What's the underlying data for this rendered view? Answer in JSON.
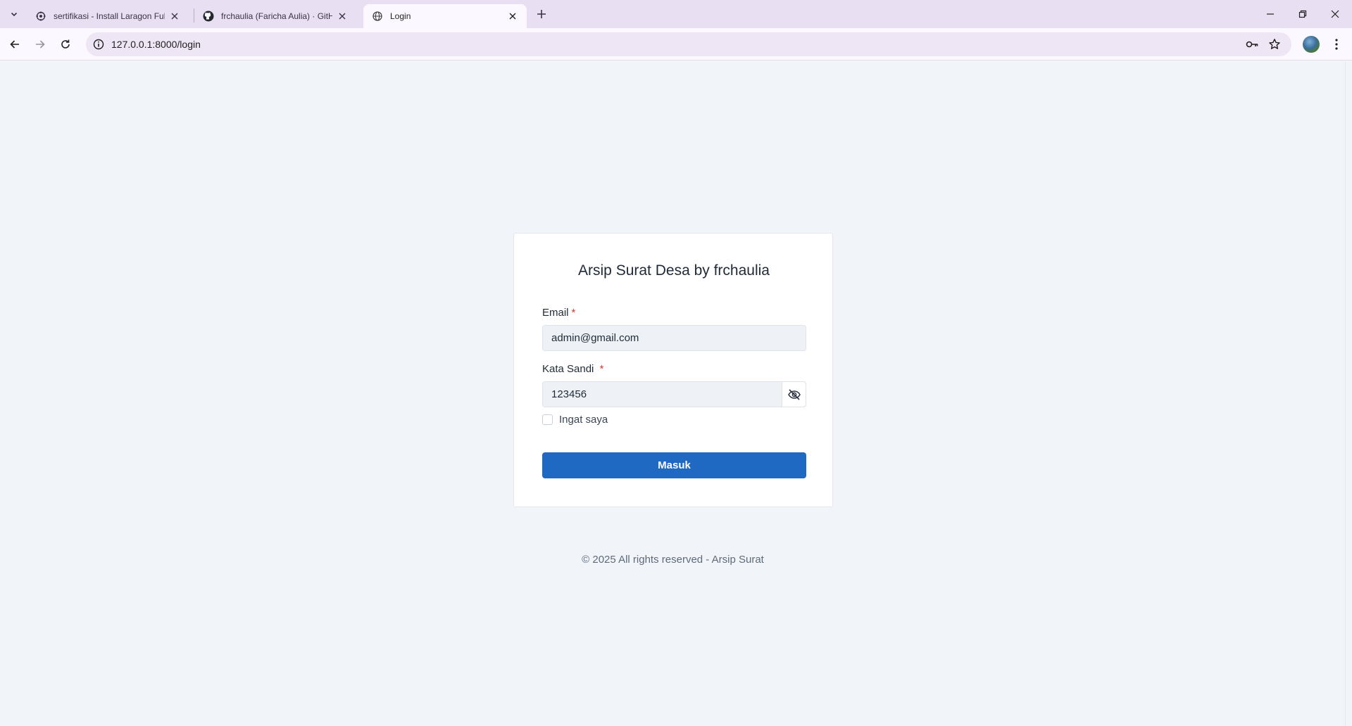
{
  "browser": {
    "tabs": [
      {
        "title": "sertifikasi - Install Laragon Full",
        "favicon": "gear-icon"
      },
      {
        "title": "frchaulia (Faricha Aulia) · GitHub",
        "favicon": "github-icon"
      },
      {
        "title": "Login",
        "favicon": "globe-icon",
        "active": true
      }
    ],
    "url": "127.0.0.1:8000/login"
  },
  "login": {
    "title": "Arsip Surat Desa by frchaulia",
    "email_label": "Email",
    "email_value": "admin@gmail.com",
    "password_label": "Kata Sandi",
    "password_value": "123456",
    "required_mark": "*",
    "remember_label": "Ingat saya",
    "remember_checked": false,
    "submit_label": "Masuk"
  },
  "footer": {
    "text": "© 2025 All rights reserved - Arsip Surat"
  },
  "colors": {
    "primary": "#1f69c2",
    "required": "#d63939",
    "page_bg": "#f1f4f8",
    "tabbar_bg": "#e9dff2"
  }
}
